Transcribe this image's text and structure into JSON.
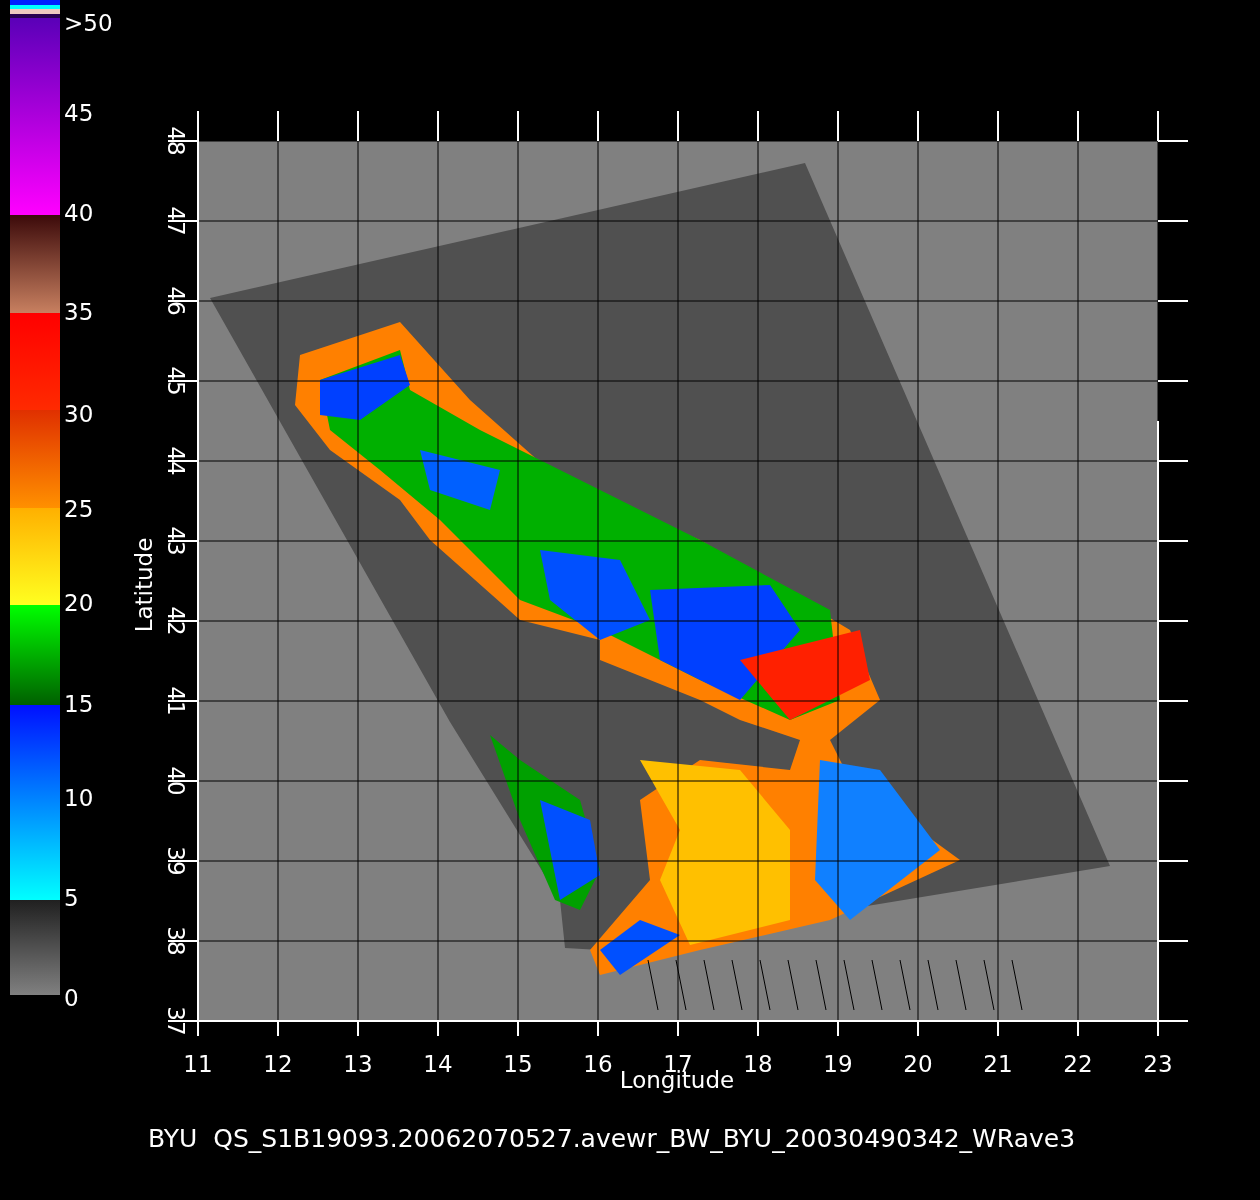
{
  "colorbar": {
    "labels": [
      ">50",
      "45",
      "40",
      "35",
      "30",
      "25",
      "20",
      "15",
      "10",
      "5",
      "0"
    ]
  },
  "plot": {
    "xlabel": "Longitude",
    "ylabel": "Latitude",
    "xticks": [
      "11",
      "12",
      "13",
      "14",
      "15",
      "16",
      "17",
      "18",
      "19",
      "20",
      "21",
      "22",
      "23"
    ],
    "yticks": [
      "37",
      "38",
      "39",
      "40",
      "41",
      "42",
      "43",
      "44",
      "45",
      "46",
      "47",
      "48"
    ]
  },
  "title": "BYU  QS_S1B19093.20062070527.avewr_BW_BYU_20030490342_WRave3"
}
